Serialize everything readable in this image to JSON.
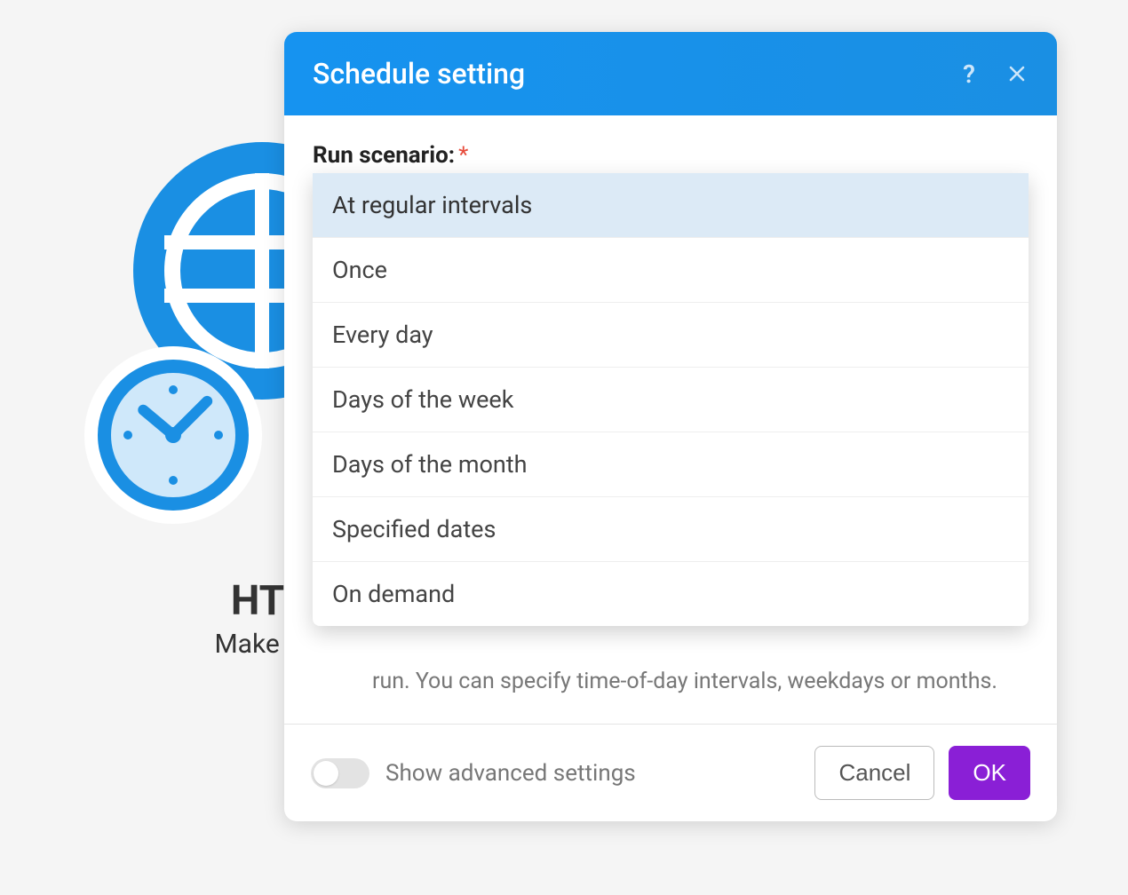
{
  "background": {
    "title_partial": "HT",
    "subtitle_partial": "Make a"
  },
  "modal": {
    "title": "Schedule setting",
    "field_label": "Run scenario:",
    "required_marker": "*",
    "select": {
      "current_value": "At regular intervals",
      "options": [
        "At regular intervals",
        "Once",
        "Every day",
        "Days of the week",
        "Days of the month",
        "Specified dates",
        "On demand"
      ],
      "selected_index": 0
    },
    "hint": "run. You can specify time-of-day intervals, weekdays or months.",
    "footer": {
      "advanced_label": "Show advanced settings",
      "advanced_toggle_on": false,
      "cancel_label": "Cancel",
      "ok_label": "OK"
    }
  }
}
